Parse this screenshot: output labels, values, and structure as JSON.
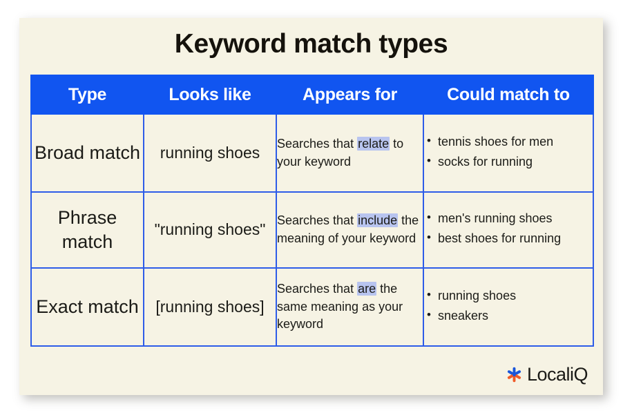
{
  "page": {
    "title": "Keyword match types",
    "background_color": "#ffffff",
    "card_color": "#f6f3e4"
  },
  "table": {
    "header_bg": "#1155f0",
    "header_text_color": "#ffffff",
    "grid_color": "#2d5ce8",
    "highlight_color": "#b8c4ef",
    "columns": [
      {
        "label": "Type"
      },
      {
        "label": "Looks like"
      },
      {
        "label": "Appears for"
      },
      {
        "label": "Could match to"
      }
    ],
    "rows": [
      {
        "type": "Broad match",
        "looks_like": "running shoes",
        "appears_for": {
          "before": "Searches that ",
          "highlight": "relate",
          "after": " to your keyword"
        },
        "could_match_to": [
          "tennis shoes for men",
          "socks for running"
        ]
      },
      {
        "type": "Phrase match",
        "looks_like": "\"running shoes\"",
        "appears_for": {
          "before": "Searches that ",
          "highlight": "include",
          "after": " the meaning of your keyword"
        },
        "could_match_to": [
          "men's running shoes",
          "best shoes for running"
        ]
      },
      {
        "type": "Exact match",
        "looks_like": "[running shoes]",
        "appears_for": {
          "before": "Searches that ",
          "highlight": "are",
          "after": " the same meaning as your keyword"
        },
        "could_match_to": [
          "running shoes",
          "sneakers"
        ]
      }
    ]
  },
  "logo": {
    "name": "LocaliQ",
    "mark_icon": "asterisk-star-icon",
    "mark_color_primary": "#1a56db",
    "mark_color_secondary": "#f05a28"
  }
}
